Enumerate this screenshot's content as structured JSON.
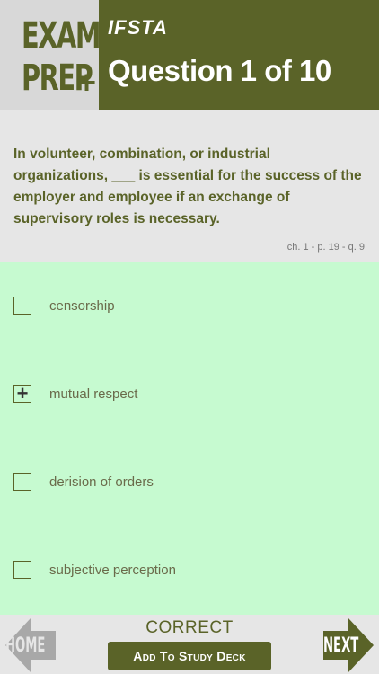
{
  "brand": {
    "logo_line1": "EXAM",
    "logo_line2": "PREP",
    "logo_plus": "+",
    "publisher": "IFSTA"
  },
  "header": {
    "title": "Question 1 of 10"
  },
  "question": {
    "text": "In volunteer, combination, or industrial organizations, ___ is essential for the success of the employer and employee if an exchange of supervisory roles is necessary.",
    "reference": "ch. 1 - p. 19 - q. 9"
  },
  "answers": [
    {
      "label": "censorship",
      "selected": false
    },
    {
      "label": "mutual respect",
      "selected": true
    },
    {
      "label": "derision of orders",
      "selected": false
    },
    {
      "label": "subjective perception",
      "selected": false
    }
  ],
  "footer": {
    "home_label": "HOME",
    "next_label": "NEXT",
    "status": "CORRECT",
    "add_to_deck_label": "Add To Study Deck"
  },
  "colors": {
    "olive": "#5a6328",
    "answer_bg": "#c6fad0",
    "panel_bg": "#e6e6e6"
  }
}
